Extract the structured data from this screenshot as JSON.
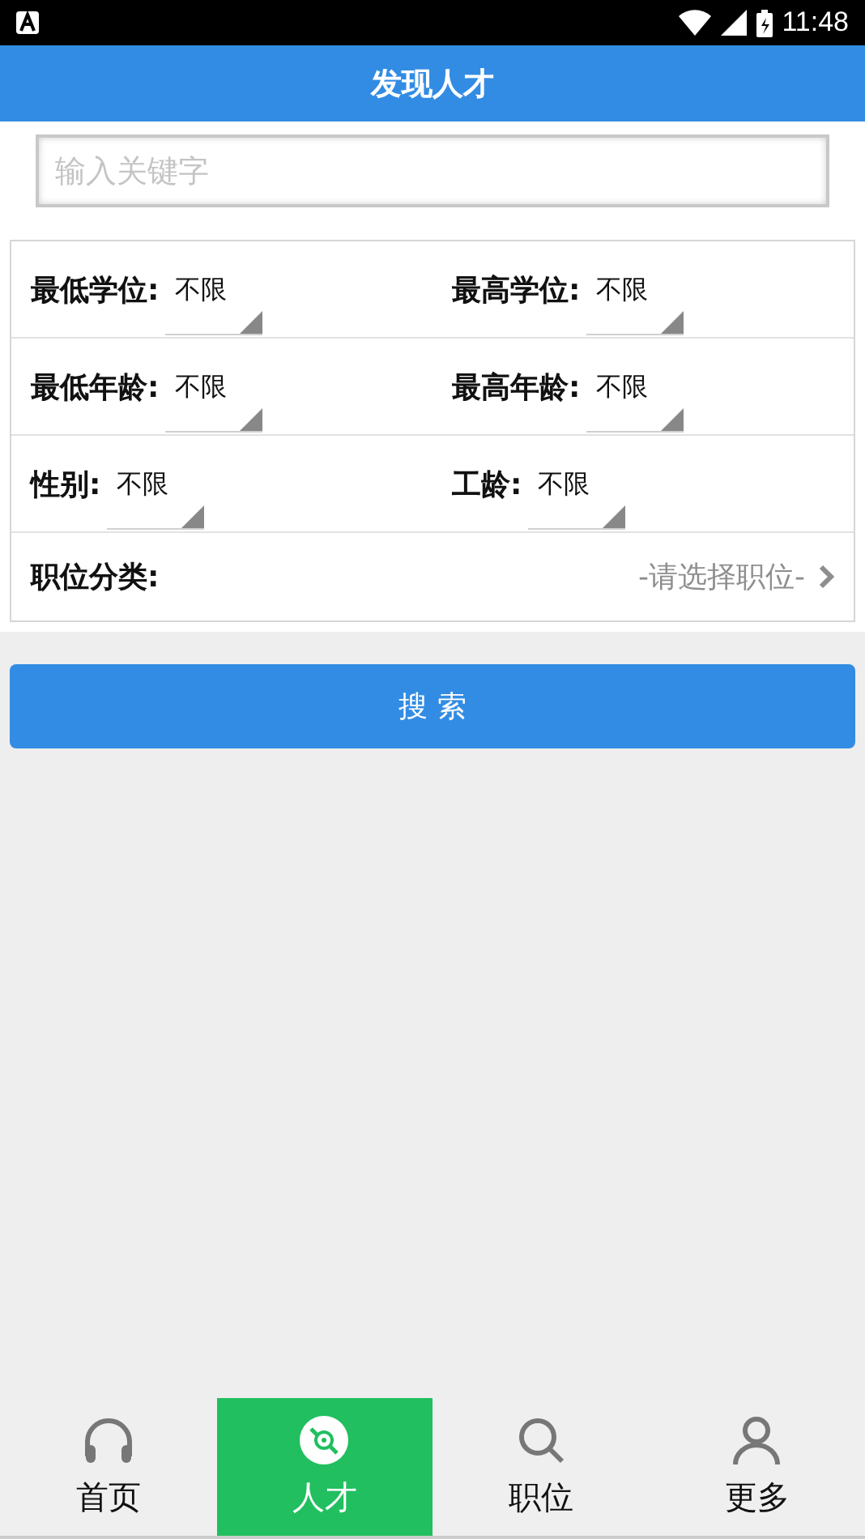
{
  "status_bar": {
    "time": "11:48"
  },
  "header": {
    "title": "发现人才"
  },
  "search": {
    "placeholder": "输入关键字"
  },
  "filters": [
    {
      "label": "最低学位:",
      "value": "不限"
    },
    {
      "label": "最高学位:",
      "value": "不限"
    },
    {
      "label": "最低年龄:",
      "value": "不限"
    },
    {
      "label": "最高年龄:",
      "value": "不限"
    },
    {
      "label": "性别:",
      "value": "不限"
    },
    {
      "label": "工龄:",
      "value": "不限"
    }
  ],
  "category": {
    "label": "职位分类:",
    "placeholder": "-请选择职位-"
  },
  "search_button": {
    "label": "搜 索"
  },
  "bottom_nav": [
    {
      "label": "首页",
      "kind": "headphones",
      "selected": false
    },
    {
      "label": "人才",
      "kind": "disc",
      "selected": true
    },
    {
      "label": "职位",
      "kind": "search",
      "selected": false
    },
    {
      "label": "更多",
      "kind": "person",
      "selected": false
    }
  ]
}
